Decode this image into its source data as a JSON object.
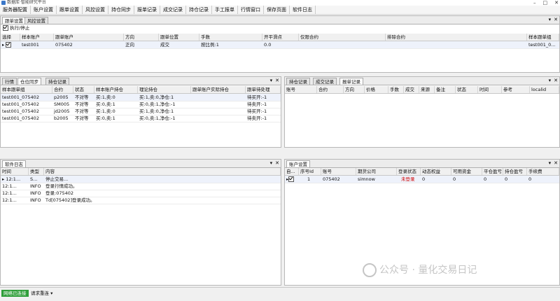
{
  "window": {
    "title": "数据库·智能研究平台"
  },
  "menu": [
    "服务器配置",
    "账户设置",
    "跟单设置",
    "风控设置",
    "持仓同步",
    "报单记录",
    "成交记录",
    "持仓记录",
    "手工报单",
    "行情窗口",
    "保存页面",
    "软件日志"
  ],
  "top_panel": {
    "tabs": [
      "跟单设置",
      "风控设置"
    ],
    "exec_label": "执行/停止",
    "columns": [
      "选择",
      "样本账户",
      "跟单账户",
      "方向",
      "跟单位置",
      "手数",
      "开平滑点",
      "仅限合约",
      "排除合约",
      "样本跟单组"
    ],
    "row": {
      "sample": "test001",
      "follow": "075402",
      "direction": "正向",
      "position": "成交",
      "lots": "按比例:1",
      "slip": "0.0",
      "only": "",
      "exclude": "",
      "group": "test001_0..."
    }
  },
  "mid_left": {
    "tabs": [
      "行情",
      "仓位同步",
      "持仓记录"
    ],
    "columns": [
      "样本跟单组",
      "合约",
      "状态",
      "样本账户持仓",
      "理论持仓",
      "跟单账户实际持仓",
      "跟单待处理"
    ],
    "rows": [
      [
        "test001_075402",
        "p2005",
        "不对等",
        "买:1,卖:0",
        "买:1,卖:0,净仓:1",
        "",
        "待买开:-1"
      ],
      [
        "test001_075402",
        "SM005",
        "不对等",
        "买:0,卖:1",
        "买:0,卖:1,净仓:-1",
        "",
        "待卖开:-1"
      ],
      [
        "test001_075402",
        "jd2005",
        "不对等",
        "买:1,卖:0",
        "买:1,卖:0,净仓:1",
        "",
        "待买开:-1"
      ],
      [
        "test001_075402",
        "b2005",
        "不对等",
        "买:0,卖:1",
        "买:0,卖:1,净仓:-1",
        "",
        "待卖开:-1"
      ]
    ]
  },
  "mid_right": {
    "tabs": [
      "持仓记录",
      "成交记录",
      "报单记录"
    ],
    "columns": [
      "账号",
      "合约",
      "方向",
      "价格",
      "手数",
      "成交",
      "来源",
      "备注",
      "状态",
      "时间",
      "参考",
      "localid"
    ]
  },
  "log_panel": {
    "tabs": [
      "软件日志"
    ],
    "columns": [
      "时间",
      "类型",
      "内容"
    ],
    "rows": [
      [
        "12:1...",
        "S...",
        "停止交易..."
      ],
      [
        "12:1...",
        "INFO",
        "登录行情成功。"
      ],
      [
        "12:1...",
        "INFO",
        "登录:075402"
      ],
      [
        "12:1...",
        "INFO",
        "Td[075402]登录成功。"
      ]
    ]
  },
  "account_panel": {
    "tabs": [
      "账户设置"
    ],
    "columns": [
      "自...",
      "序号Id",
      "账号",
      "期货公司",
      "登录状态",
      "动态权益",
      "可用资金",
      "平仓盈亏",
      "持仓盈亏",
      "手续费"
    ],
    "row": {
      "id": "1",
      "account": "075402",
      "company": "simnow",
      "status": "未登录",
      "equity": "0",
      "avail": "0",
      "close_pl": "0",
      "pos_pl": "0",
      "fee": "0"
    }
  },
  "status": {
    "network": "网络已连接",
    "request": "请求重连"
  },
  "watermark": "公众号 · 量化交易日记"
}
